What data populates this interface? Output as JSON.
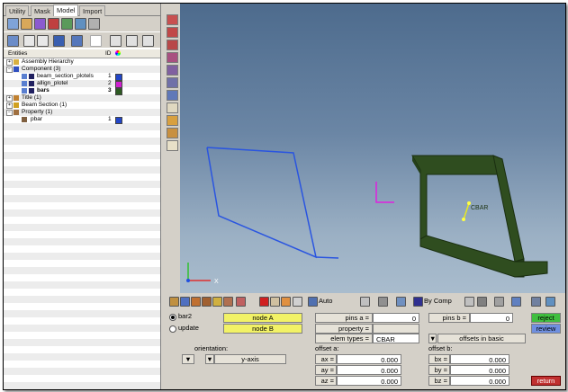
{
  "tabs": [
    "Utility",
    "Mask",
    "Model",
    "Import"
  ],
  "active_tab": "Model",
  "entity_header": {
    "entities": "Entities",
    "id": "ID"
  },
  "tree": [
    {
      "label": "Assembly Hierarchy",
      "level": 0,
      "icon": "assembly-icon"
    },
    {
      "label": "Component (3)",
      "level": 0,
      "icon": "component-icon"
    },
    {
      "label": "beam_section_plotels",
      "level": 1,
      "id": "1",
      "color": "#2246c8",
      "icon": "component-item-icon"
    },
    {
      "label": "allign_plotel",
      "level": 1,
      "id": "2",
      "color": "#d020d0",
      "icon": "component-item-icon"
    },
    {
      "label": "bars",
      "level": 1,
      "id": "3",
      "color": "#2d5a22",
      "bold": true,
      "icon": "component-item-icon"
    },
    {
      "label": "Title (1)",
      "level": 0,
      "icon": "title-icon"
    },
    {
      "label": "Beam Section (1)",
      "level": 0,
      "icon": "beam-section-icon"
    },
    {
      "label": "Property (1)",
      "level": 0,
      "icon": "property-icon"
    },
    {
      "label": "pbar",
      "level": 1,
      "id": "1",
      "color": "#2246c8",
      "icon": "property-item-icon"
    }
  ],
  "viewport": {
    "axis_x": "X",
    "element_label": "CBAR",
    "colors": {
      "plotel": "#2a55e0",
      "beam": "#2f4d1f",
      "align": "#e020e0",
      "element": "#e8e820"
    }
  },
  "toolbar2": {
    "display_mode": "Auto",
    "color_mode": "By Comp"
  },
  "form": {
    "radio_bar2": "bar2",
    "radio_update": "update",
    "node_a": "node A",
    "node_b": "node B",
    "pins_a_label": "pins  a =",
    "pins_a_value": "0",
    "pins_b_label": "pins b =",
    "pins_b_value": "0",
    "property_label": "property =",
    "elem_types_label": "elem types =",
    "elem_types_value": "CBAR",
    "offsets_basic": "offsets in basic",
    "orientation_label": "orientation:",
    "y_axis": "y-axis",
    "offset_a_label": "offset a:",
    "offset_b_label": "offset b:",
    "ax_label": "ax =",
    "ax_value": "0.000",
    "ay_label": "ay =",
    "ay_value": "0.000",
    "az_label": "az =",
    "az_value": "0.000",
    "bx_label": "bx =",
    "bx_value": "0.000",
    "by_label": "by =",
    "by_value": "0.000",
    "bz_label": "bz =",
    "bz_value": "0.000",
    "reject": "reject",
    "review": "review",
    "return": "return"
  }
}
